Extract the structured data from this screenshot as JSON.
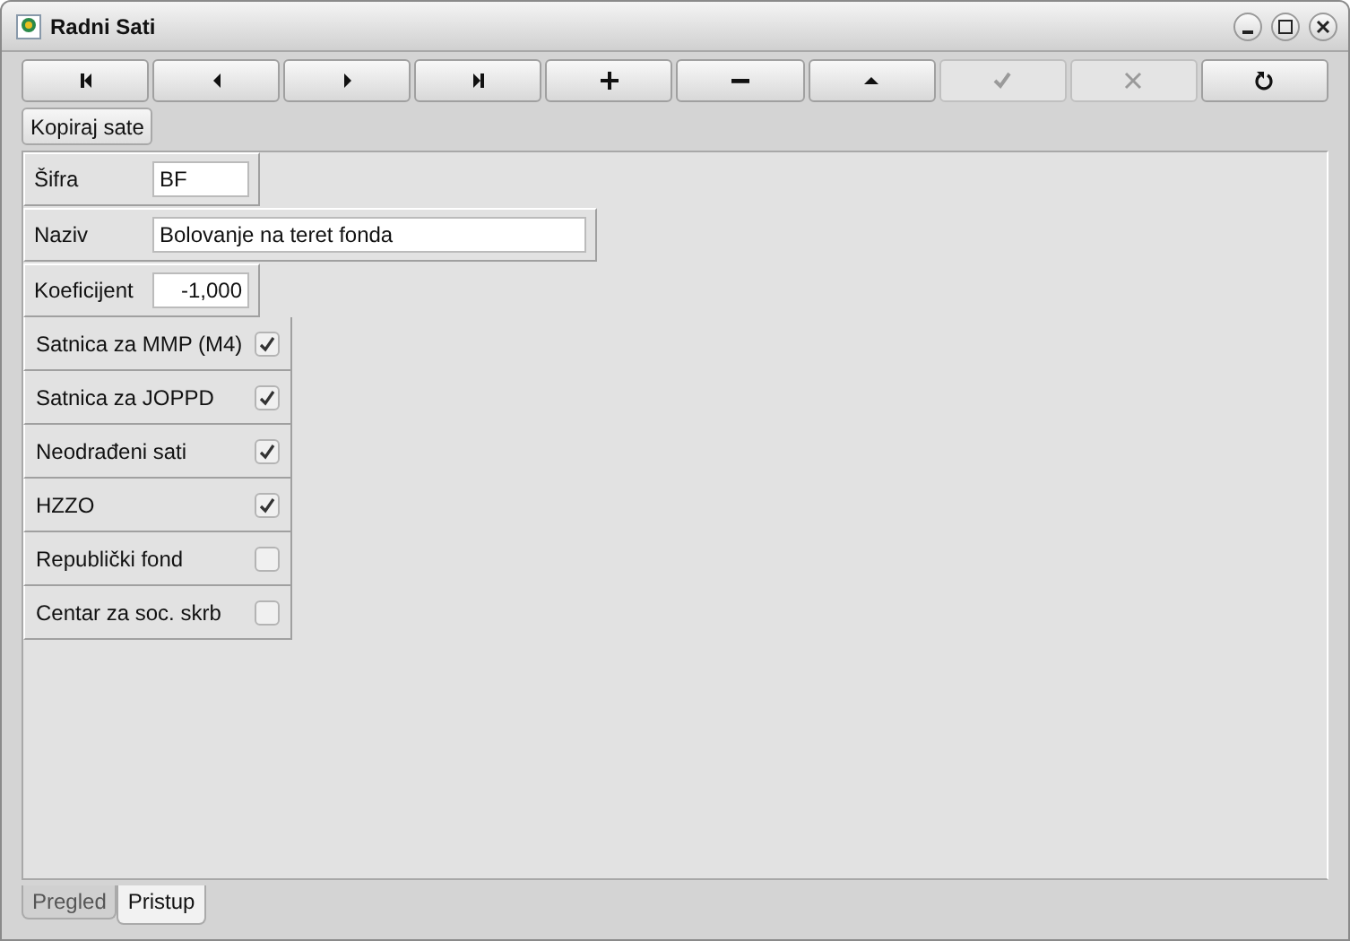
{
  "window": {
    "title": "Radni Sati"
  },
  "toolbar": [
    {
      "kind": "first",
      "disabled": false
    },
    {
      "kind": "prev",
      "disabled": false
    },
    {
      "kind": "next",
      "disabled": false
    },
    {
      "kind": "last",
      "disabled": false
    },
    {
      "kind": "add",
      "disabled": false
    },
    {
      "kind": "remove",
      "disabled": false
    },
    {
      "kind": "up",
      "disabled": false
    },
    {
      "kind": "confirm",
      "disabled": true
    },
    {
      "kind": "cancel",
      "disabled": true
    },
    {
      "kind": "refresh",
      "disabled": false
    }
  ],
  "copy_button": "Kopiraj sate",
  "fields": [
    {
      "label": "Šifra",
      "value": "BF",
      "kind": "code"
    },
    {
      "label": "Naziv",
      "value": "Bolovanje na teret fonda",
      "kind": "text"
    },
    {
      "label": "Koeficijent",
      "value": "-1,000",
      "kind": "number"
    }
  ],
  "checks": [
    {
      "label": "Satnica za MMP (M4)",
      "checked": true
    },
    {
      "label": "Satnica za JOPPD",
      "checked": true
    },
    {
      "label": "Neodrađeni sati",
      "checked": true
    },
    {
      "label": "HZZO",
      "checked": true
    },
    {
      "label": "Republički fond",
      "checked": false
    },
    {
      "label": "Centar za soc. skrb",
      "checked": false
    }
  ],
  "tabs": [
    {
      "label": "Pregled",
      "selected": false
    },
    {
      "label": "Pristup",
      "selected": true
    }
  ]
}
